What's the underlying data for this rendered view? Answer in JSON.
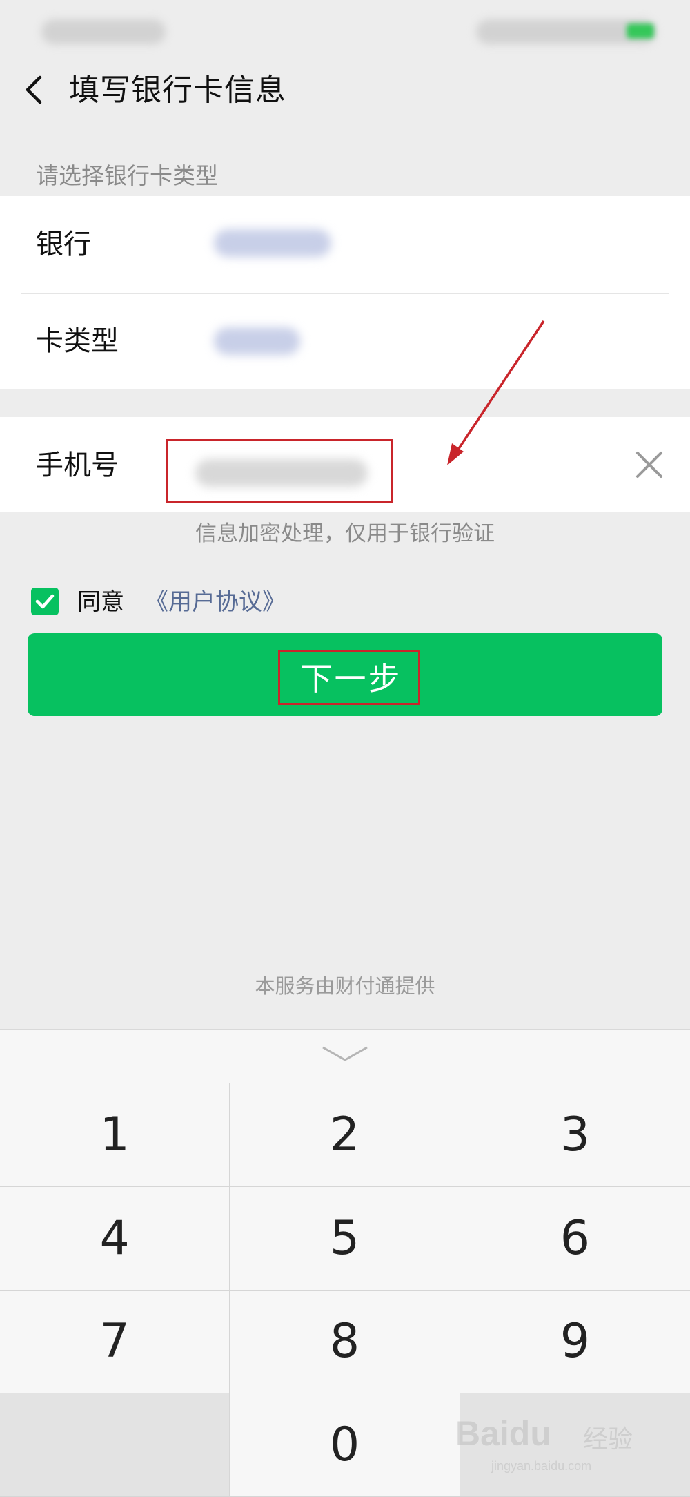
{
  "nav": {
    "title": "填写银行卡信息",
    "back_icon": "chevron-left-icon"
  },
  "section_hint": "请选择银行卡类型",
  "bank_card": {
    "bank_label": "银行",
    "card_type_label": "卡类型"
  },
  "phone": {
    "label": "手机号",
    "clear_icon": "close-icon"
  },
  "info_text": "信息加密处理，仅用于银行验证",
  "agreement": {
    "checked": true,
    "agree_label": "同意",
    "link_text": "《用户协议》"
  },
  "next_button": {
    "label": "下一步"
  },
  "provider_text": "本服务由财付通提供",
  "keyboard": {
    "collapse_icon": "chevron-down-icon",
    "keys": [
      "1",
      "2",
      "3",
      "4",
      "5",
      "6",
      "7",
      "8",
      "9",
      "",
      "0",
      ""
    ]
  },
  "watermark": {
    "logo": "Baidu",
    "text": "经验",
    "url": "jingyan.baidu.com"
  },
  "colors": {
    "accent": "#07c160",
    "link": "#576b95",
    "annotation": "#c9252b"
  }
}
